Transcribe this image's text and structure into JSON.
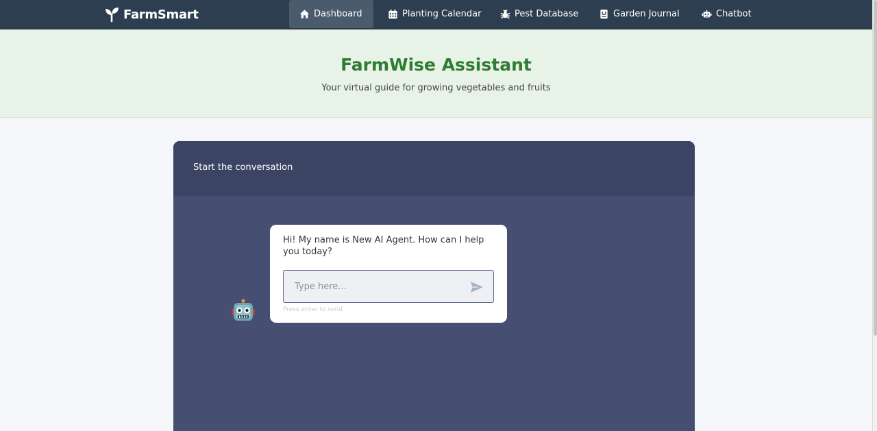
{
  "brand": {
    "name": "FarmSmart"
  },
  "nav": {
    "items": [
      {
        "label": "Dashboard",
        "icon": "home-icon",
        "active": true
      },
      {
        "label": "Planting Calendar",
        "icon": "calendar-icon",
        "active": false
      },
      {
        "label": "Pest Database",
        "icon": "bug-icon",
        "active": false
      },
      {
        "label": "Garden Journal",
        "icon": "journal-icon",
        "active": false
      },
      {
        "label": "Chatbot",
        "icon": "robot-icon",
        "active": false
      }
    ]
  },
  "hero": {
    "title": "FarmWise Assistant",
    "subtitle": "Your virtual guide for growing vegetables and fruits"
  },
  "chat": {
    "header": "Start the conversation",
    "bot_message": "Hi! My name is New AI Agent. How can I help you today?",
    "input_placeholder": "Type here...",
    "input_value": "",
    "hint": "Press enter to send"
  },
  "colors": {
    "navbar": "#2c3e50",
    "nav_active": "#4a5b6c",
    "hero_bg": "#e8f3e8",
    "title_green": "#2e7d32",
    "panel": "#464e72",
    "panel_header": "#3c4463"
  }
}
